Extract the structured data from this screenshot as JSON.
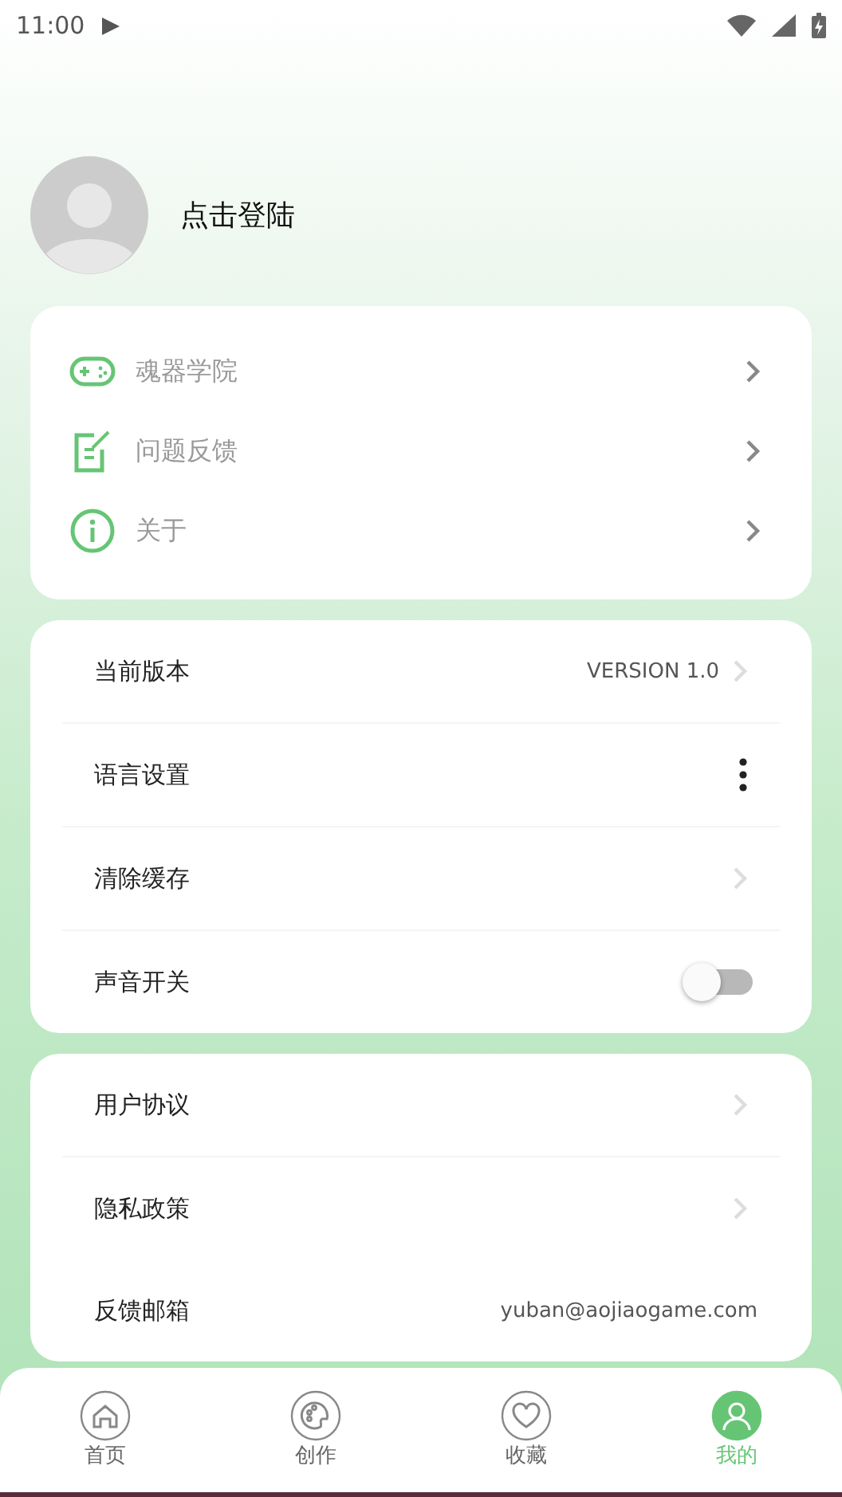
{
  "status_bar": {
    "time": "11:00"
  },
  "profile": {
    "login_label": "点击登陆"
  },
  "menu": [
    {
      "kind": "gamepad",
      "label": "魂器学院"
    },
    {
      "kind": "note",
      "label": "问题反馈"
    },
    {
      "kind": "info",
      "label": "关于"
    }
  ],
  "settings": [
    {
      "kind": "value",
      "label": "当前版本",
      "value": "VERSION 1.0"
    },
    {
      "kind": "menu",
      "label": "语言设置"
    },
    {
      "kind": "link",
      "label": "清除缓存"
    },
    {
      "kind": "switch",
      "label": "声音开关",
      "on": false
    }
  ],
  "legal": [
    {
      "kind": "link",
      "label": "用户协议"
    },
    {
      "kind": "link",
      "label": "隐私政策"
    },
    {
      "kind": "text",
      "label": "反馈邮箱",
      "value": "yuban@aojiaogame.com"
    }
  ],
  "tabs": [
    {
      "kind": "home",
      "label": "首页",
      "selected": false
    },
    {
      "kind": "palette",
      "label": "创作",
      "selected": false
    },
    {
      "kind": "heart",
      "label": "收藏",
      "selected": false
    },
    {
      "kind": "user",
      "label": "我的",
      "selected": true
    }
  ]
}
